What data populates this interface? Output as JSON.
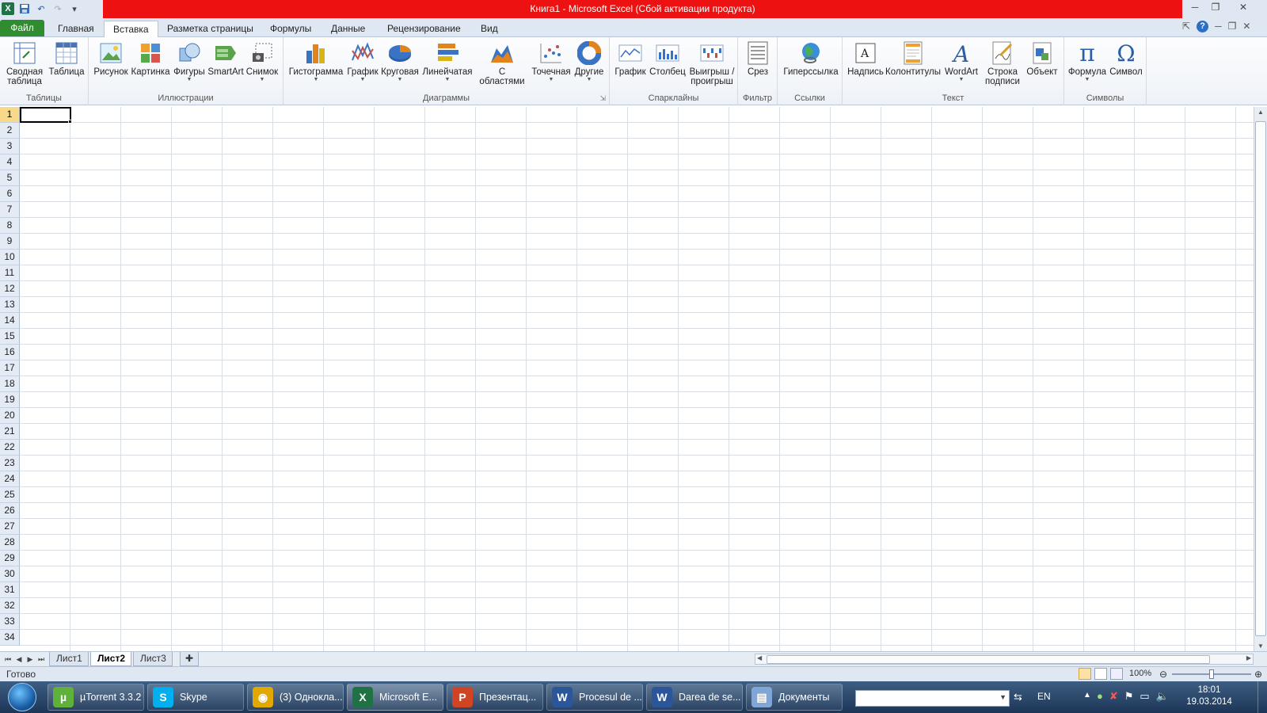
{
  "window": {
    "title": "Книга1  -  Microsoft Excel (Сбой активации продукта)"
  },
  "ribbon_tabs": {
    "file": "Файл",
    "home": "Главная",
    "insert": "Вставка",
    "page_layout": "Разметка страницы",
    "formulas": "Формулы",
    "data": "Данные",
    "review": "Рецензирование",
    "view": "Вид"
  },
  "groups": {
    "tables": {
      "label": "Таблицы",
      "pivot_line1": "Сводная",
      "pivot_line2": "таблица",
      "table": "Таблица"
    },
    "illustrations": {
      "label": "Иллюстрации",
      "picture": "Рисунок",
      "clipart": "Картинка",
      "shapes": "Фигуры",
      "smartart": "SmartArt",
      "screenshot": "Снимок"
    },
    "charts": {
      "label": "Диаграммы",
      "column": "Гистограмма",
      "line": "График",
      "pie": "Круговая",
      "bar": "Линейчатая",
      "area_line1": "С",
      "area_line2": "областями",
      "scatter": "Точечная",
      "other": "Другие"
    },
    "sparklines": {
      "label": "Спарклайны",
      "line": "График",
      "column": "Столбец",
      "winloss_line1": "Выигрыш /",
      "winloss_line2": "проигрыш"
    },
    "filter": {
      "label": "Фильтр",
      "slicer": "Срез"
    },
    "links": {
      "label": "Ссылки",
      "hyperlink": "Гиперссылка"
    },
    "text": {
      "label": "Текст",
      "textbox": "Надпись",
      "headerfooter": "Колонтитулы",
      "wordart": "WordArt",
      "sigline_line1": "Строка",
      "sigline_line2": "подписи",
      "object": "Объект"
    },
    "symbols": {
      "label": "Символы",
      "equation": "Формула",
      "symbol": "Символ"
    }
  },
  "rows": [
    "1",
    "2",
    "3",
    "4",
    "5",
    "6",
    "7",
    "8",
    "9",
    "10",
    "11",
    "12",
    "13",
    "14",
    "15",
    "16",
    "17",
    "18",
    "19",
    "20",
    "21",
    "22",
    "23",
    "24",
    "25",
    "26",
    "27",
    "28",
    "29",
    "30",
    "31",
    "32",
    "33",
    "34"
  ],
  "sheets": [
    "Лист1",
    "Лист2",
    "Лист3"
  ],
  "active_sheet": "Лист2",
  "status": {
    "ready": "Готово",
    "zoom": "100%"
  },
  "taskbar": {
    "items": [
      {
        "label": "µTorrent 3.3.2",
        "icon": "utorrent-icon",
        "color": "#5fb13b"
      },
      {
        "label": "Skype",
        "icon": "skype-icon",
        "color": "#00aff0"
      },
      {
        "label": "(3) Однокла...",
        "icon": "chrome-icon",
        "color": "#e0a800"
      },
      {
        "label": "Microsoft E...",
        "icon": "excel-icon",
        "color": "#1f7244"
      },
      {
        "label": "Презентац...",
        "icon": "powerpoint-icon",
        "color": "#d04423"
      },
      {
        "label": "Procesul de ...",
        "icon": "word-icon",
        "color": "#2b579a"
      },
      {
        "label": "Darea de se...",
        "icon": "word-icon",
        "color": "#2b579a"
      },
      {
        "label": "Документы",
        "icon": "documents-icon",
        "color": "#7fa6d6"
      }
    ],
    "lang": "EN",
    "time": "18:01",
    "date": "19.03.2014"
  },
  "colors": {
    "title_bar": "#ee1111",
    "file_tab": "#2f8c2f",
    "selected_row_header": "#f8d889"
  }
}
